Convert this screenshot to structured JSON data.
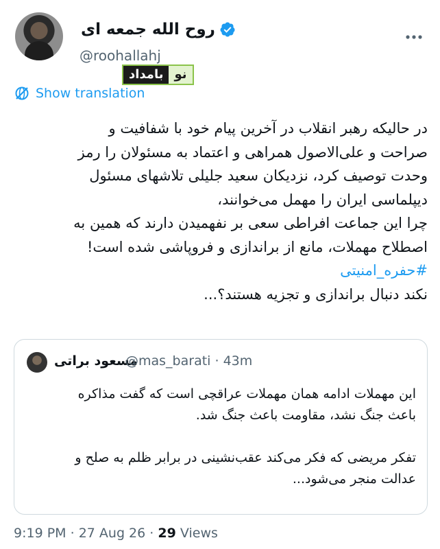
{
  "author": {
    "display_name": "روح الله جمعه ای",
    "handle": "@roohallahj",
    "verified_icon": "verified-badge",
    "accent_color": "#1d9bf0"
  },
  "watermark": {
    "main": "بامداد",
    "accent": "نو"
  },
  "translate": {
    "label": "Show translation",
    "icon": "globe-slash"
  },
  "tweet": {
    "lines": [
      "در حالیکه رهبر انقلاب در آخرین پیام خود با شفافیت و",
      "صراحت و علی‌الاصول همراهی و اعتماد به مسئولان را رمز",
      "وحدت توصیف کرد، نزدیکان سعید جلیلی تلاشهای مسئول",
      "دیپلماسی ایران را مهمل می‌خوانند،",
      "چرا این جماعت افراطی سعی بر نفهمیدن دارند که همین به",
      "اصطلاح مهملات، مانع از براندازی و فروپاشی شده است!"
    ],
    "hashtag": "#حفره_امنیتی",
    "last_line": "نکند دنبال براندازی و تجزیه هستند؟..."
  },
  "quote": {
    "name": "مسعود براتی",
    "handle": "@mas_barati",
    "separator": "·",
    "time": "43m",
    "paragraph1": [
      "این مهملات ادامه همان مهملات عراقچی است که گفت مذاکره",
      "باعث جنگ نشد، مقاومت باعث جنگ شد."
    ],
    "paragraph2": [
      "تفکر مریضی که فکر می‌کند عقب‌نشینی در برابر ظلم به صلح و",
      "عدالت منجر می‌شود..."
    ]
  },
  "footer": {
    "time": "9:19 PM",
    "dot1": "·",
    "date": "27 Aug 26",
    "dot2": "·",
    "views_count": "29",
    "views_label": "Views"
  }
}
